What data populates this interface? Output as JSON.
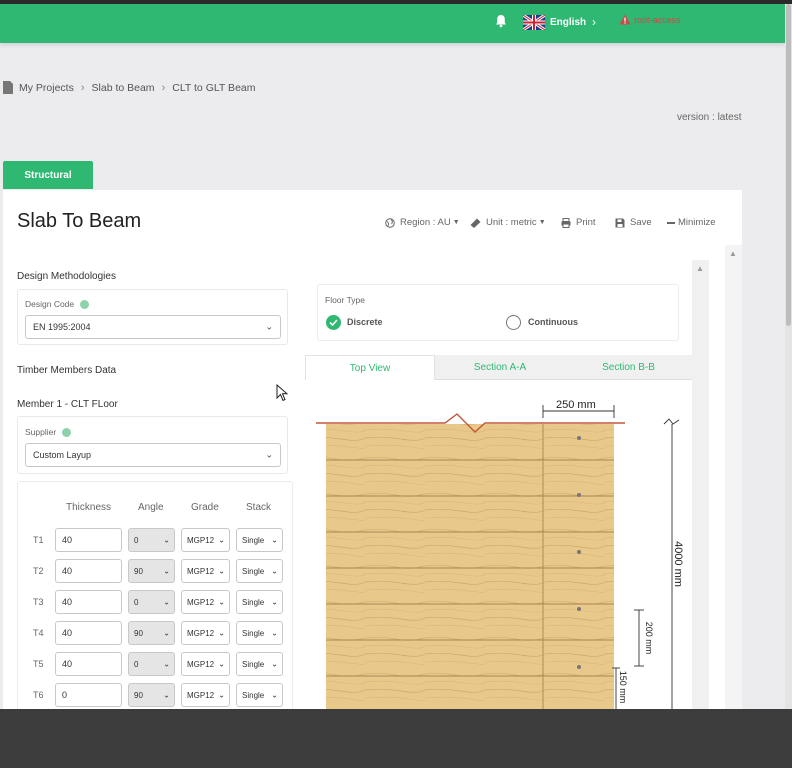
{
  "header": {
    "language": "English",
    "access": "root-access",
    "bell_icon": "bell-icon",
    "flag_icon": "uk-flag-icon"
  },
  "breadcrumb": [
    "My Projects",
    "Slab to Beam",
    "CLT to GLT Beam"
  ],
  "version": "version : latest",
  "tab": "Structural",
  "page_title": "Slab To Beam",
  "toolbar": {
    "region": "Region : AU",
    "unit": "Unit : metric",
    "print": "Print",
    "save": "Save",
    "minimize": "Minimize"
  },
  "design": {
    "section_title": "Design Methodologies",
    "code_label": "Design Code",
    "code_value": "EN 1995:2004"
  },
  "timber": {
    "section_title": "Timber Members Data",
    "member_title": "Member 1 - CLT FLoor",
    "supplier_label": "Supplier",
    "supplier_value": "Custom Layup"
  },
  "layers": {
    "headers": [
      "Thickness",
      "Angle",
      "Grade",
      "Stack"
    ],
    "rows": [
      {
        "label": "T1",
        "thickness": "40",
        "angle": "0",
        "grade": "MGP12",
        "stack": "Single"
      },
      {
        "label": "T2",
        "thickness": "40",
        "angle": "90",
        "grade": "MGP12",
        "stack": "Single"
      },
      {
        "label": "T3",
        "thickness": "40",
        "angle": "0",
        "grade": "MGP12",
        "stack": "Single"
      },
      {
        "label": "T4",
        "thickness": "40",
        "angle": "90",
        "grade": "MGP12",
        "stack": "Single"
      },
      {
        "label": "T5",
        "thickness": "40",
        "angle": "0",
        "grade": "MGP12",
        "stack": "Single"
      },
      {
        "label": "T6",
        "thickness": "0",
        "angle": "90",
        "grade": "MGP12",
        "stack": "Single"
      }
    ]
  },
  "floor_type": {
    "label": "Floor Type",
    "options": [
      "Discrete",
      "Continuous"
    ],
    "selected": "Discrete"
  },
  "view_tabs": [
    "Top View",
    "Section A-A",
    "Section B-B"
  ],
  "active_view": "Top View",
  "drawing": {
    "dim_width": "250 mm",
    "dim_length": "4000 mm",
    "dim_spacing": "200 mm",
    "dim_edge": "150 mm"
  },
  "colors": {
    "brand": "#2eb872",
    "wood": "#e8c98a",
    "beam_line": "#c0573a"
  }
}
